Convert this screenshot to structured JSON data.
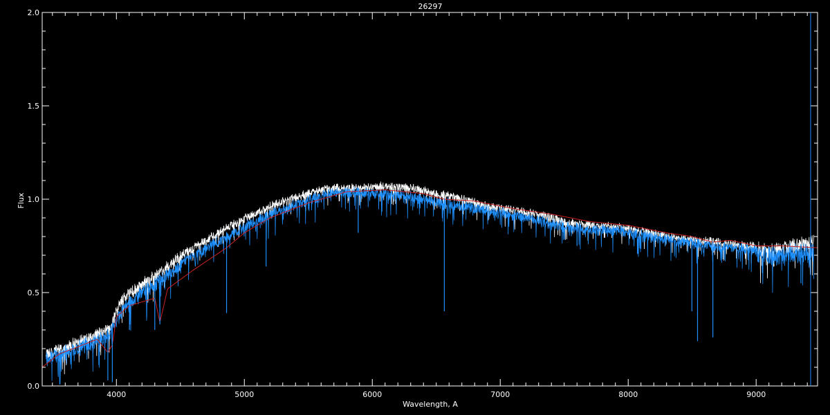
{
  "chart_data": {
    "type": "line",
    "title": "26297",
    "xlabel": "Wavelength, A",
    "ylabel": "Flux",
    "xlim": [
      3420,
      9480
    ],
    "ylim": [
      0.0,
      2.0
    ],
    "x_ticks": [
      4000,
      5000,
      6000,
      7000,
      8000,
      9000
    ],
    "x_tick_labels": [
      "4000",
      "5000",
      "6000",
      "7000",
      "8000",
      "9000"
    ],
    "y_ticks": [
      0.0,
      0.5,
      1.0,
      1.5,
      2.0
    ],
    "y_tick_labels": [
      "0.0",
      "0.5",
      "1.0",
      "1.5",
      "2.0"
    ],
    "grid": false,
    "colors": {
      "background": "#000000",
      "axes": "#ffffff",
      "observed": "#1e90ff",
      "upper_envelope": "#ffffff",
      "model": "#cc2222"
    },
    "series": [
      {
        "color": "#ffffff",
        "x": [
          3450,
          3600,
          3800,
          3950,
          4050,
          4200,
          4350,
          4500,
          4700,
          4900,
          5100,
          5300,
          5500,
          5700,
          5900,
          6100,
          6300,
          6500,
          6700,
          6900,
          7100,
          7300,
          7500,
          7700,
          7900,
          8100,
          8300,
          8500,
          8700,
          8900,
          9100,
          9300,
          9450
        ],
        "y": [
          0.2,
          0.23,
          0.29,
          0.34,
          0.5,
          0.57,
          0.64,
          0.72,
          0.8,
          0.88,
          0.95,
          1.01,
          1.05,
          1.08,
          1.08,
          1.09,
          1.08,
          1.05,
          1.02,
          0.98,
          0.96,
          0.94,
          0.9,
          0.88,
          0.87,
          0.85,
          0.82,
          0.8,
          0.79,
          0.77,
          0.76,
          0.78,
          0.8
        ]
      },
      {
        "color": "#1e90ff",
        "x": [
          3450,
          3600,
          3800,
          3950,
          4050,
          4200,
          4350,
          4500,
          4700,
          4900,
          5100,
          5300,
          5500,
          5700,
          5900,
          6100,
          6300,
          6500,
          6700,
          6900,
          7100,
          7300,
          7500,
          7700,
          7900,
          8100,
          8300,
          8500,
          8700,
          8900,
          9100,
          9300,
          9450
        ],
        "y": [
          0.18,
          0.21,
          0.26,
          0.31,
          0.45,
          0.53,
          0.6,
          0.68,
          0.76,
          0.84,
          0.91,
          0.97,
          1.02,
          1.06,
          1.06,
          1.05,
          1.04,
          1.01,
          0.99,
          0.96,
          0.94,
          0.91,
          0.88,
          0.86,
          0.86,
          0.83,
          0.81,
          0.79,
          0.77,
          0.76,
          0.74,
          0.76,
          0.76
        ]
      },
      {
        "color": "#cc2222",
        "x": [
          3420,
          3550,
          3700,
          3850,
          3933,
          3968,
          4000,
          4102,
          4200,
          4300,
          4340,
          4400,
          4600,
          4861,
          5000,
          5200,
          5500,
          5800,
          6100,
          6400,
          6563,
          6800,
          7100,
          7400,
          7700,
          8000,
          8300,
          8500,
          8662,
          8800,
          9000,
          9200,
          9480
        ],
        "y": [
          0.1,
          0.17,
          0.21,
          0.25,
          0.18,
          0.22,
          0.37,
          0.43,
          0.45,
          0.47,
          0.34,
          0.52,
          0.62,
          0.74,
          0.82,
          0.9,
          0.98,
          1.04,
          1.05,
          1.03,
          1.0,
          0.99,
          0.95,
          0.92,
          0.88,
          0.86,
          0.82,
          0.8,
          0.77,
          0.78,
          0.75,
          0.75,
          0.74
        ]
      }
    ],
    "absorption_lines": [
      {
        "x": 3933,
        "min": 0.03
      },
      {
        "x": 3968,
        "min": 0.02
      },
      {
        "x": 4102,
        "min": 0.3
      },
      {
        "x": 4300,
        "min": 0.3
      },
      {
        "x": 4340,
        "min": 0.33
      },
      {
        "x": 4861,
        "min": 0.39
      },
      {
        "x": 5170,
        "min": 0.64
      },
      {
        "x": 5890,
        "min": 0.82
      },
      {
        "x": 6563,
        "min": 0.4
      },
      {
        "x": 7600,
        "min": 0.75
      },
      {
        "x": 8498,
        "min": 0.4
      },
      {
        "x": 8542,
        "min": 0.24
      },
      {
        "x": 8662,
        "min": 0.26
      },
      {
        "x": 9350,
        "min": 0.55
      }
    ]
  }
}
